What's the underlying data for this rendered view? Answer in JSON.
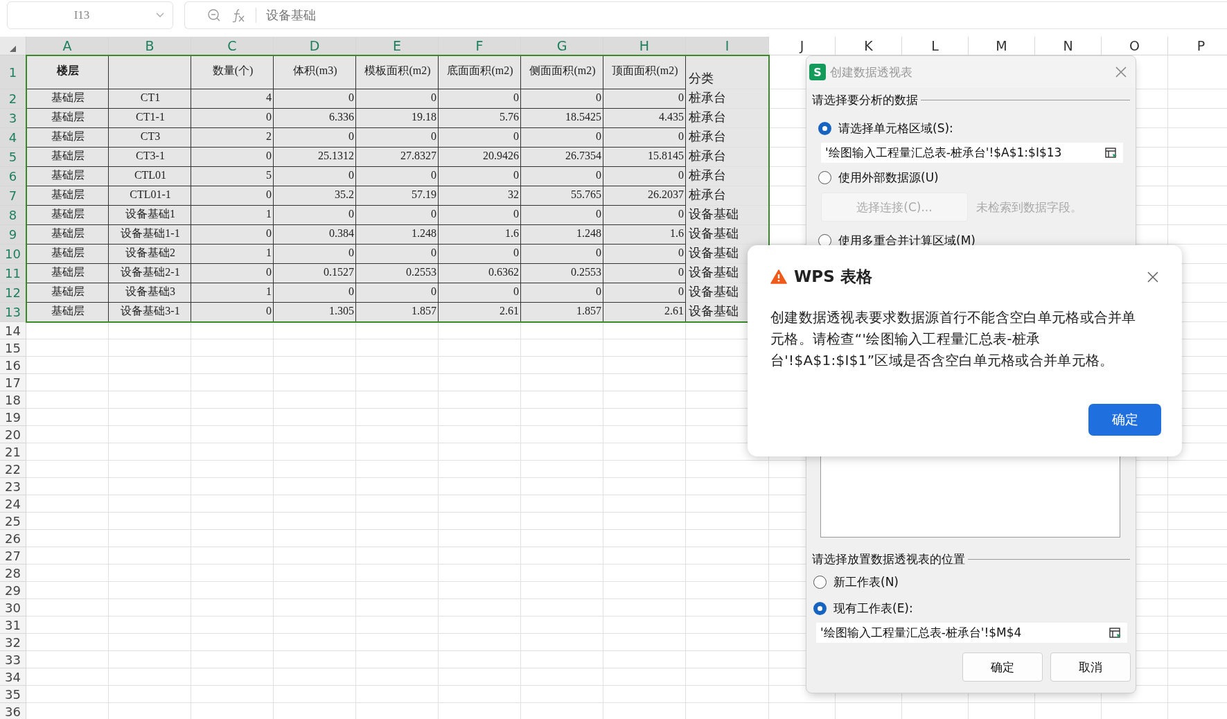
{
  "name_box": "I13",
  "formula": "设备基础",
  "columns": [
    {
      "label": "A",
      "selected": true
    },
    {
      "label": "B",
      "selected": true
    },
    {
      "label": "C",
      "selected": true
    },
    {
      "label": "D",
      "selected": true
    },
    {
      "label": "E",
      "selected": true
    },
    {
      "label": "F",
      "selected": true
    },
    {
      "label": "G",
      "selected": true
    },
    {
      "label": "H",
      "selected": true
    },
    {
      "label": "I",
      "selected": true
    },
    {
      "label": "J",
      "selected": false
    },
    {
      "label": "K",
      "selected": false
    },
    {
      "label": "L",
      "selected": false
    },
    {
      "label": "M",
      "selected": false
    },
    {
      "label": "N",
      "selected": false
    },
    {
      "label": "O",
      "selected": false
    },
    {
      "label": "P",
      "selected": false
    }
  ],
  "rows": [
    {
      "number": "1",
      "selected": true,
      "cells": [
        "楼层",
        null,
        "数量(个)",
        "体积(m3)",
        "模板面积(m2)",
        "底面面积(m2)",
        "侧面面积(m2)",
        "顶面面积(m2)",
        "分类"
      ]
    },
    {
      "number": "2",
      "selected": true,
      "cells": [
        "基础层",
        "CT1",
        "4",
        "0",
        "0",
        "0",
        "0",
        "0",
        "桩承台"
      ]
    },
    {
      "number": "3",
      "selected": true,
      "cells": [
        "基础层",
        "CT1-1",
        "0",
        "6.336",
        "19.18",
        "5.76",
        "18.5425",
        "4.435",
        "桩承台"
      ]
    },
    {
      "number": "4",
      "selected": true,
      "cells": [
        "基础层",
        "CT3",
        "2",
        "0",
        "0",
        "0",
        "0",
        "0",
        "桩承台"
      ]
    },
    {
      "number": "5",
      "selected": true,
      "cells": [
        "基础层",
        "CT3-1",
        "0",
        "25.1312",
        "27.8327",
        "20.9426",
        "26.7354",
        "15.8145",
        "桩承台"
      ]
    },
    {
      "number": "6",
      "selected": true,
      "cells": [
        "基础层",
        "CTL01",
        "5",
        "0",
        "0",
        "0",
        "0",
        "0",
        "桩承台"
      ]
    },
    {
      "number": "7",
      "selected": true,
      "cells": [
        "基础层",
        "CTL01-1",
        "0",
        "35.2",
        "57.19",
        "32",
        "55.765",
        "26.2037",
        "桩承台"
      ]
    },
    {
      "number": "8",
      "selected": true,
      "cells": [
        "基础层",
        "设备基础1",
        "1",
        "0",
        "0",
        "0",
        "0",
        "0",
        "设备基础"
      ]
    },
    {
      "number": "9",
      "selected": true,
      "cells": [
        "基础层",
        "设备基础1-1",
        "0",
        "0.384",
        "1.248",
        "1.6",
        "1.248",
        "1.6",
        "设备基础"
      ]
    },
    {
      "number": "10",
      "selected": true,
      "cells": [
        "基础层",
        "设备基础2",
        "1",
        "0",
        "0",
        "0",
        "0",
        "0",
        "设备基础"
      ]
    },
    {
      "number": "11",
      "selected": true,
      "cells": [
        "基础层",
        "设备基础2-1",
        "0",
        "0.1527",
        "0.2553",
        "0.6362",
        "0.2553",
        "0",
        "设备基础"
      ]
    },
    {
      "number": "12",
      "selected": true,
      "cells": [
        "基础层",
        "设备基础3",
        "1",
        "0",
        "0",
        "0",
        "0",
        "0",
        "设备基础"
      ]
    },
    {
      "number": "13",
      "selected": true,
      "cells": [
        "基础层",
        "设备基础3-1",
        "0",
        "1.305",
        "1.857",
        "2.61",
        "1.857",
        "2.61",
        "设备基础"
      ]
    },
    {
      "number": "14",
      "selected": false
    },
    {
      "number": "15",
      "selected": false
    },
    {
      "number": "16",
      "selected": false
    },
    {
      "number": "17",
      "selected": false
    },
    {
      "number": "18",
      "selected": false
    },
    {
      "number": "19",
      "selected": false
    },
    {
      "number": "20",
      "selected": false
    },
    {
      "number": "21",
      "selected": false
    },
    {
      "number": "22",
      "selected": false
    },
    {
      "number": "23",
      "selected": false
    },
    {
      "number": "24",
      "selected": false
    },
    {
      "number": "25",
      "selected": false
    },
    {
      "number": "26",
      "selected": false
    },
    {
      "number": "27",
      "selected": false
    },
    {
      "number": "28",
      "selected": false
    },
    {
      "number": "29",
      "selected": false
    },
    {
      "number": "30",
      "selected": false
    },
    {
      "number": "31",
      "selected": false
    },
    {
      "number": "32",
      "selected": false
    },
    {
      "number": "33",
      "selected": false
    },
    {
      "number": "34",
      "selected": false
    },
    {
      "number": "35",
      "selected": false
    },
    {
      "number": "36",
      "selected": false
    }
  ],
  "pivot_dialog": {
    "app_icon": "S",
    "title": "创建数据透视表",
    "source_heading": "请选择要分析的数据",
    "source_options": [
      {
        "label": "请选择单元格区域(S):",
        "selected": true
      },
      {
        "label": "使用外部数据源(U)",
        "selected": false
      },
      {
        "label": "使用多重合并计算区域(M)",
        "selected": false
      }
    ],
    "range_value": "'绘图输入工程量汇总表-桩承台'!$A$1:$I$13",
    "connect_button": {
      "label": "选择连接(C)...",
      "disabled": true
    },
    "connect_note": "未检索到数据字段。",
    "place_heading": "请选择放置数据透视表的位置",
    "place_options": [
      {
        "label": "新工作表(N)",
        "selected": false
      },
      {
        "label": "现有工作表(E):",
        "selected": true
      }
    ],
    "place_value": "'绘图输入工程量汇总表-桩承台'!$M$4",
    "buttons": [
      "确定",
      "取消"
    ]
  },
  "alert": {
    "title": "WPS 表格",
    "message": "创建数据透视表要求数据源首行不能含空白单元格或合并单元格。请检查“'绘图输入工程量汇总表-桩承台'!$A$1:$I$1”区域是否含空白单元格或合并单元格。",
    "button": "确定"
  }
}
